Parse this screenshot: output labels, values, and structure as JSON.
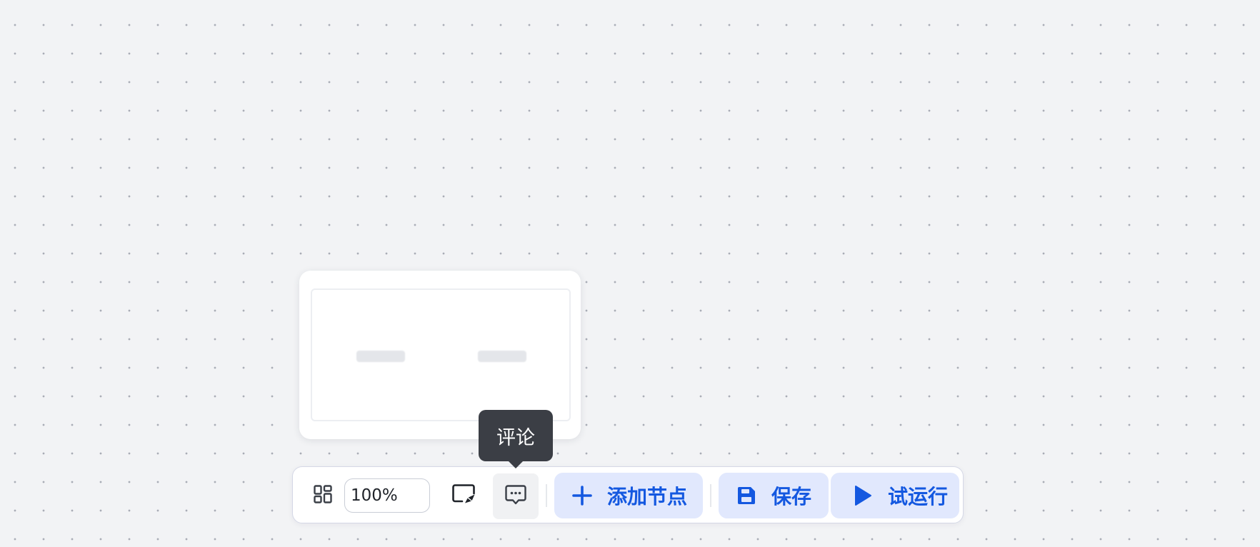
{
  "minimap": {
    "nodes": 2
  },
  "tooltip": {
    "text": "评论"
  },
  "toolbar": {
    "zoom_value": "100%",
    "add_node_label": "添加节点",
    "save_label": "保存",
    "run_label": "试运行",
    "icons": {
      "layout": "layout-grid-icon",
      "note": "note-icon",
      "comment": "comment-icon",
      "add": "plus-icon",
      "save": "save-icon",
      "run": "play-icon"
    }
  },
  "colors": {
    "accent": "#1458e0",
    "button_bg": "#e1e8fd",
    "canvas_bg": "#f2f3f5",
    "tooltip_bg": "#3b3e45"
  }
}
